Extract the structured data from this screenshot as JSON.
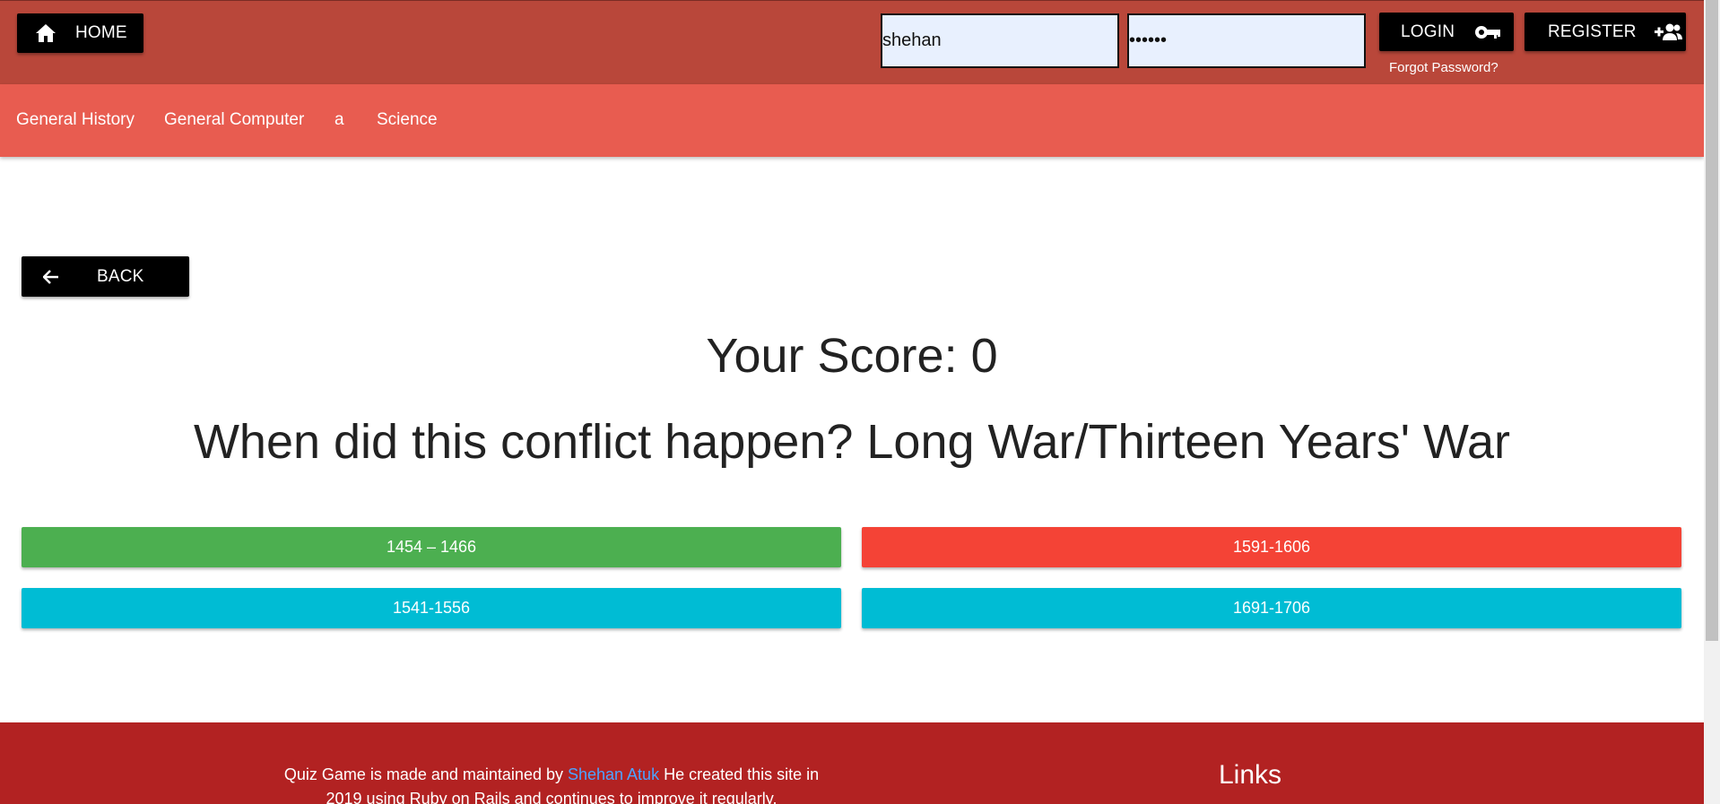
{
  "header": {
    "home_label": "HOME",
    "username_value": "shehan",
    "password_value": "••••••",
    "login_label": "LOGIN",
    "register_label": "REGISTER",
    "forgot_label": "Forgot Password?"
  },
  "categories": [
    "General History",
    "General Computer",
    "a",
    "Science"
  ],
  "quiz": {
    "back_label": "BACK",
    "score_text": "Your Score: 0",
    "question_text": "When did this conflict happen? Long War/Thirteen Years' War",
    "answers": [
      {
        "label": "1454 – 1466",
        "color": "#4caf50"
      },
      {
        "label": "1591-1606",
        "color": "#f44336"
      },
      {
        "label": "1541-1556",
        "color": "#00bcd4"
      },
      {
        "label": "1691-1706",
        "color": "#00bcd4"
      }
    ]
  },
  "footer": {
    "text_before": "Quiz Game is made and maintained by ",
    "author_link": "Shehan Atuk",
    "text_after": " He created this site in 2019 using Ruby on Rails and continues to improve it regularly.",
    "links_heading": "Links"
  },
  "colors": {
    "topbar": "#b9473a",
    "category_bar": "#e85c50",
    "footer": "#b22222",
    "correct": "#4caf50",
    "wrong": "#f44336",
    "neutral": "#00bcd4"
  },
  "icons": [
    "home-icon",
    "key-icon",
    "add-user-icon",
    "arrow-left-icon"
  ]
}
